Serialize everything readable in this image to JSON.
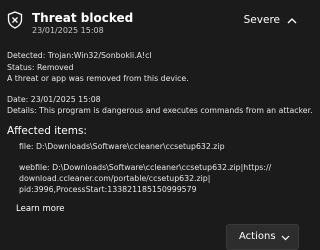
{
  "header": {
    "title": "Threat blocked",
    "datetime": "23/01/2025 15:08",
    "severity": "Severe",
    "icon": "shield-warning-icon",
    "collapse_icon": "chevron-up-icon"
  },
  "details": {
    "detected": "Detected:  Trojan:Win32/Sonbokli.A!cl",
    "status": "Status:  Removed",
    "status_note": "A threat or app was removed from this device.",
    "date": "Date:  23/01/2025 15:08",
    "description": "Details:  This program is dangerous and executes commands from an attacker."
  },
  "affected": {
    "heading": "Affected items:",
    "file": "file:  D:\\Downloads\\Software\\ccleaner\\ccsetup632.zip",
    "webfile_line1": "webfile:  D:\\Downloads\\Software\\ccleaner\\ccsetup632.zip|https://",
    "webfile_line2": "download.ccleaner.com/portable/ccsetup632.zip|",
    "webfile_line3": "pid:3996,ProcessStart:133821185150999579"
  },
  "learn_more": "Learn more",
  "actions_button": {
    "label": "Actions",
    "icon": "chevron-down-icon"
  },
  "colors": {
    "background": "#1b1b1b",
    "text": "#ffffff",
    "button": "#2d2d2d"
  }
}
